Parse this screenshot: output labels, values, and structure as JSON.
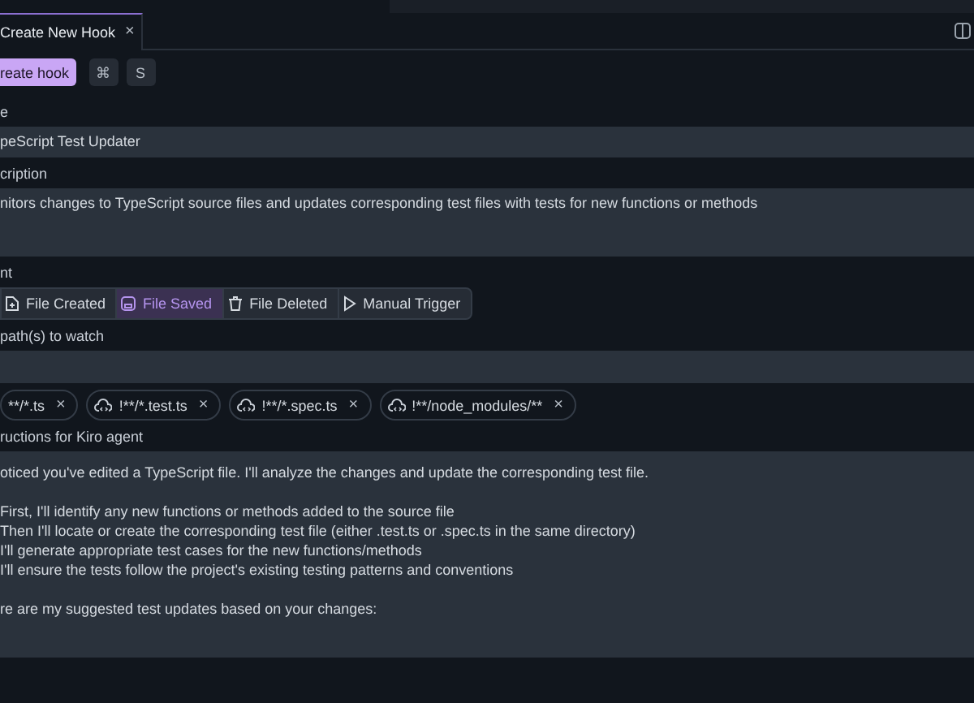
{
  "tab": {
    "label": "Create New Hook",
    "close": "×"
  },
  "actions": {
    "primary": "reate hook",
    "keys": [
      "⌘",
      "S"
    ]
  },
  "name_field": {
    "label": "e",
    "value": "peScript Test Updater"
  },
  "description_field": {
    "label": "cription",
    "value": "nitors changes to TypeScript source files and updates corresponding test files with tests for new functions or methods"
  },
  "event": {
    "label": "nt",
    "options": [
      {
        "label": "File Created",
        "selected": false
      },
      {
        "label": "File Saved",
        "selected": true
      },
      {
        "label": "File Deleted",
        "selected": false
      },
      {
        "label": "Manual Trigger",
        "selected": false
      }
    ]
  },
  "paths": {
    "label": "path(s) to watch",
    "chips": [
      {
        "label": "**/*.ts",
        "kind": "plain",
        "remove": "×"
      },
      {
        "label": "!**/*.test.ts",
        "kind": "cloud",
        "remove": "×"
      },
      {
        "label": "!**/*.spec.ts",
        "kind": "cloud",
        "remove": "×"
      },
      {
        "label": "!**/node_modules/**",
        "kind": "cloud",
        "remove": "×"
      }
    ]
  },
  "instructions": {
    "label": "ructions for Kiro agent",
    "paragraphs": [
      [
        "oticed you've edited a TypeScript file. I'll analyze the changes and update the corresponding test file."
      ],
      [
        "First, I'll identify any new functions or methods added to the source file",
        "Then I'll locate or create the corresponding test file (either .test.ts or .spec.ts in the same directory)",
        "I'll generate appropriate test cases for the new functions/methods",
        "I'll ensure the tests follow the project's existing testing patterns and conventions"
      ],
      [
        "re are my suggested test updates based on your changes:"
      ]
    ]
  }
}
